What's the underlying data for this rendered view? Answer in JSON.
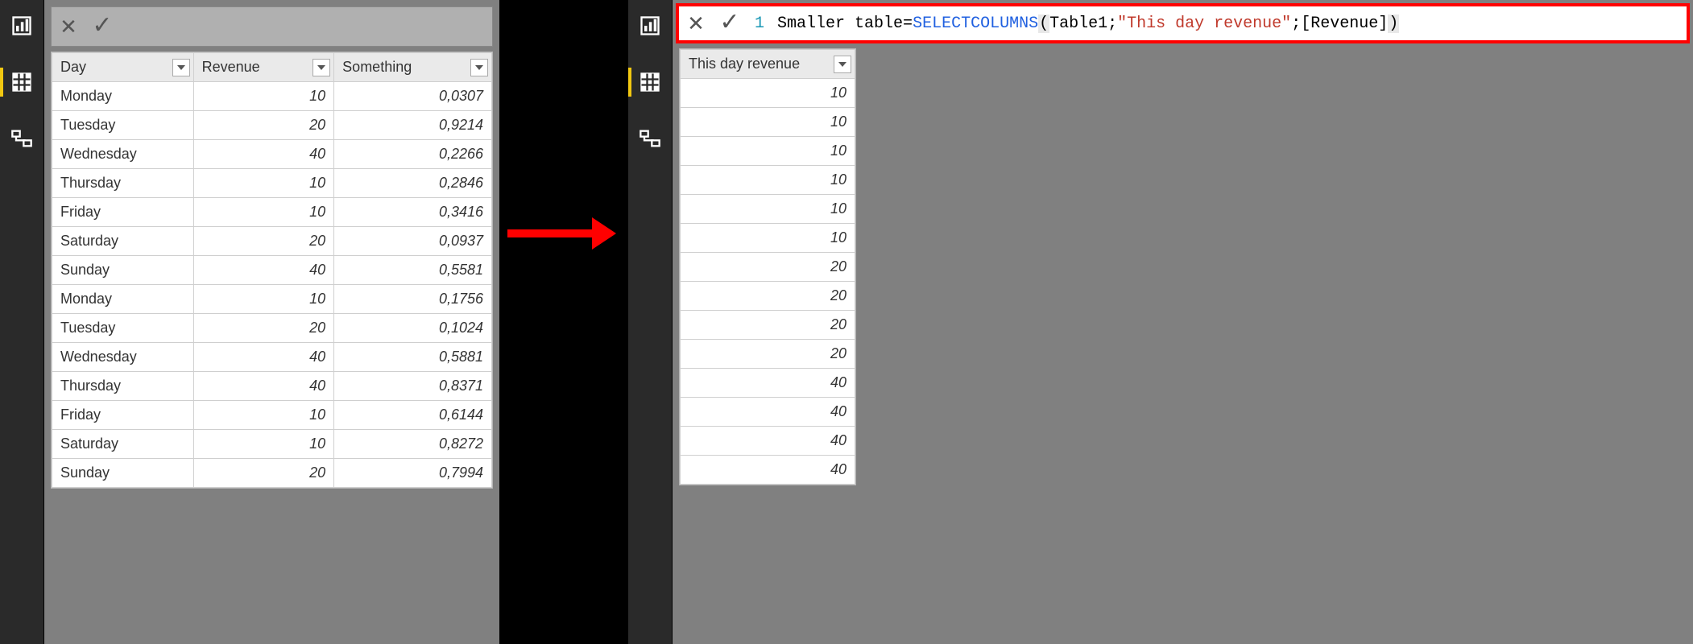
{
  "leftPane": {
    "formula": {
      "lineNo": "",
      "text": ""
    },
    "table": {
      "columns": [
        "Day",
        "Revenue",
        "Something"
      ],
      "rows": [
        {
          "day": "Monday",
          "revenue": "10",
          "something": "0,0307"
        },
        {
          "day": "Tuesday",
          "revenue": "20",
          "something": "0,9214"
        },
        {
          "day": "Wednesday",
          "revenue": "40",
          "something": "0,2266"
        },
        {
          "day": "Thursday",
          "revenue": "10",
          "something": "0,2846"
        },
        {
          "day": "Friday",
          "revenue": "10",
          "something": "0,3416"
        },
        {
          "day": "Saturday",
          "revenue": "20",
          "something": "0,0937"
        },
        {
          "day": "Sunday",
          "revenue": "40",
          "something": "0,5581"
        },
        {
          "day": "Monday",
          "revenue": "10",
          "something": "0,1756"
        },
        {
          "day": "Tuesday",
          "revenue": "20",
          "something": "0,1024"
        },
        {
          "day": "Wednesday",
          "revenue": "40",
          "something": "0,5881"
        },
        {
          "day": "Thursday",
          "revenue": "40",
          "something": "0,8371"
        },
        {
          "day": "Friday",
          "revenue": "10",
          "something": "0,6144"
        },
        {
          "day": "Saturday",
          "revenue": "10",
          "something": "0,8272"
        },
        {
          "day": "Sunday",
          "revenue": "20",
          "something": "0,7994"
        }
      ]
    }
  },
  "rightPane": {
    "formula": {
      "lineNo": "1",
      "name": "Smaller table",
      "eq": " = ",
      "fn": "SELECTCOLUMNS",
      "open": "(",
      "arg1": "Table1",
      "sep1": ";",
      "arg2": "\"This day revenue\"",
      "sep2": ";",
      "arg3": "[Revenue]",
      "close": ")"
    },
    "table": {
      "columns": [
        "This day revenue"
      ],
      "rows": [
        {
          "v": "10"
        },
        {
          "v": "10"
        },
        {
          "v": "10"
        },
        {
          "v": "10"
        },
        {
          "v": "10"
        },
        {
          "v": "10"
        },
        {
          "v": "20"
        },
        {
          "v": "20"
        },
        {
          "v": "20"
        },
        {
          "v": "20"
        },
        {
          "v": "40"
        },
        {
          "v": "40"
        },
        {
          "v": "40"
        },
        {
          "v": "40"
        }
      ]
    }
  },
  "icons": {
    "cancel": "✕",
    "commit": "✓"
  }
}
